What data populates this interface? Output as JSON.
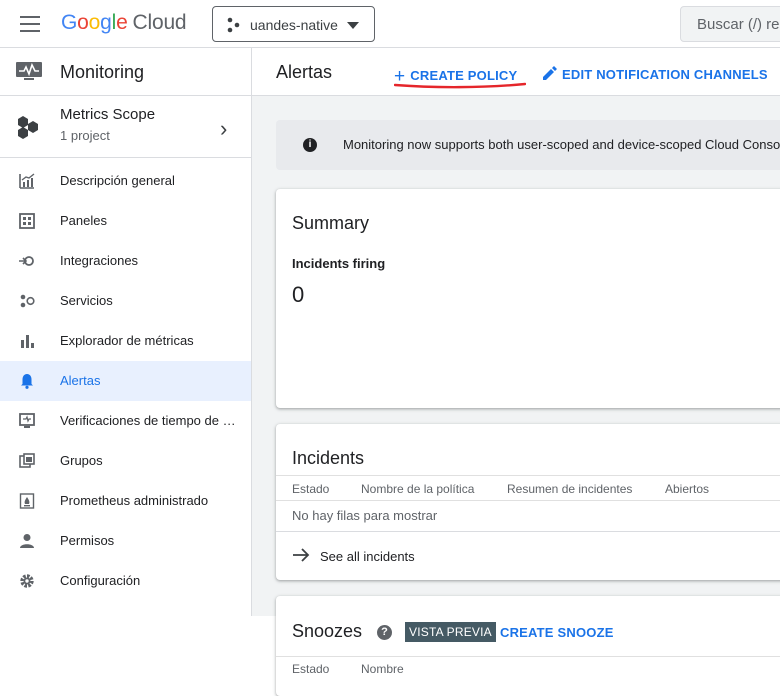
{
  "topbar": {
    "logo_google": "Google",
    "logo_cloud": "Cloud",
    "project": "uandes-native",
    "search_placeholder": "Buscar (/) re"
  },
  "sidebar": {
    "title": "Monitoring",
    "scope_title": "Metrics Scope",
    "scope_sub": "1 project",
    "items": [
      {
        "label": "Descripción general",
        "icon": "overview-chart-icon"
      },
      {
        "label": "Paneles",
        "icon": "dashboard-icon"
      },
      {
        "label": "Integraciones",
        "icon": "integrations-icon"
      },
      {
        "label": "Servicios",
        "icon": "services-icon"
      },
      {
        "label": "Explorador de métricas",
        "icon": "bar-chart-icon"
      },
      {
        "label": "Alertas",
        "icon": "bell-icon",
        "active": true
      },
      {
        "label": "Verificaciones de tiempo de …",
        "icon": "monitor-icon"
      },
      {
        "label": "Grupos",
        "icon": "groups-icon"
      },
      {
        "label": "Prometheus administrado",
        "icon": "prometheus-icon"
      },
      {
        "label": "Permisos",
        "icon": "person-icon"
      },
      {
        "label": "Configuración",
        "icon": "gear-icon"
      }
    ]
  },
  "main": {
    "title": "Alertas",
    "create_policy": "CREATE POLICY",
    "edit_channels": "EDIT NOTIFICATION CHANNELS",
    "banner": "Monitoring now supports both user-scoped and device-scoped Cloud Conso",
    "summary": {
      "title": "Summary",
      "firing_label": "Incidents firing",
      "firing_value": "0"
    },
    "incidents": {
      "title": "Incidents",
      "columns": [
        "Estado",
        "Nombre de la política",
        "Resumen de incidentes",
        "Abiertos"
      ],
      "empty": "No hay filas para mostrar",
      "see_all": "See all incidents"
    },
    "snoozes": {
      "title": "Snoozes",
      "badge": "VISTA PREVIA",
      "create": "CREATE SNOOZE",
      "columns": [
        "Estado",
        "Nombre"
      ]
    }
  },
  "colors": {
    "accent": "#1a73e8",
    "active_bg": "#e8f0fe",
    "annotation": "#e5262b"
  }
}
